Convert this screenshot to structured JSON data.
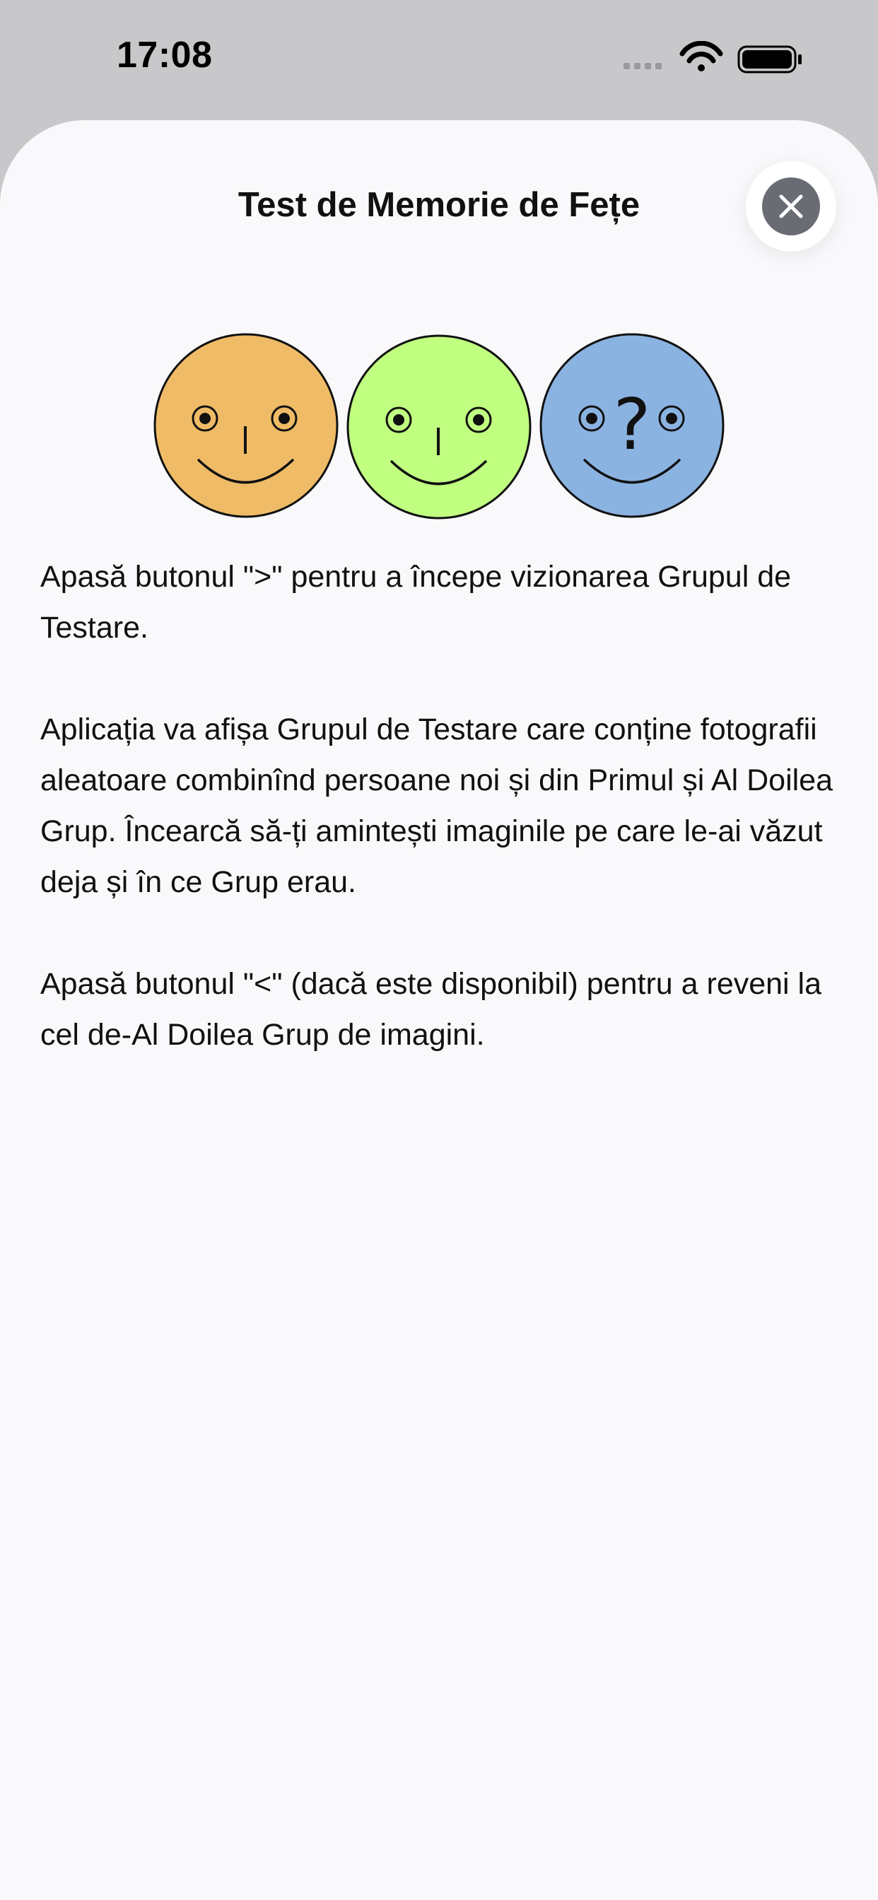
{
  "status": {
    "time": "17:08",
    "icons": [
      "cellular-icon",
      "wifi-icon",
      "battery-icon"
    ]
  },
  "sheet": {
    "title": "Test de Memorie de Fețe",
    "close_icon": "close-icon"
  },
  "illustration": {
    "faces": [
      {
        "name": "orange-face",
        "color": "#efbb67",
        "mark": "nose"
      },
      {
        "name": "green-face",
        "color": "#c0ff80",
        "mark": "nose"
      },
      {
        "name": "blue-face",
        "color": "#8bb3e1",
        "mark": "?"
      }
    ]
  },
  "instructions": {
    "p1": "Apasă butonul \">\" pentru a începe vizionarea Grupul de Testare.",
    "p2": "Aplicația va afișa Grupul de Testare care conține fotografii aleatoare combinînd persoane noi și din Primul și Al Doilea Grup. Încearcă să-ți amintești imaginile pe care le-ai văzut deja și în ce Grup erau.",
    "p3": "Apasă butonul \"<\" (dacă este disponibil) pentru a reveni la cel de-Al Doilea Grup de imagini."
  }
}
